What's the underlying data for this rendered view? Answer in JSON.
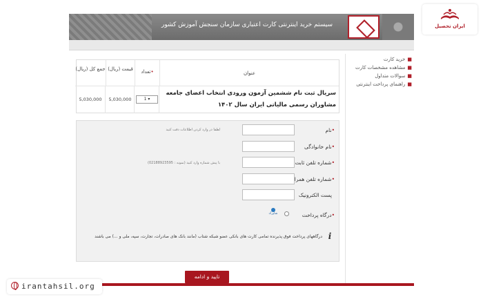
{
  "banner": {
    "title": "سیستم خرید اینترنتی کارت اعتباری سازمان سنجش آموزش کشور"
  },
  "brand": {
    "name": "ایران تحصیل"
  },
  "sidebar": {
    "items": [
      {
        "label": "خرید کارت"
      },
      {
        "label": "مشاهده مشخصات کارت"
      },
      {
        "label": "سوالات متداول"
      },
      {
        "label": "راهنمای پرداخت اینترنتی"
      }
    ]
  },
  "order": {
    "headers": {
      "title": "عنوان",
      "qty": "تعداد",
      "price": "قیمت (ریال)",
      "total": "جمع کل (ریال)"
    },
    "row": {
      "title": "سریال ثبت نام ششمین آزمون ورودی انتخاب اعضای جامعه مشاوران رسمی مالیاتی ایران سال ۱۴۰۲",
      "qty": "1",
      "price": "5,030,000",
      "total": "5,030,000"
    }
  },
  "form": {
    "first_name": {
      "label": "نام",
      "required": true,
      "hint": "لطفا در وارد کردن اطلاعات دقت کنید"
    },
    "last_name": {
      "label": "نام خانوادگی",
      "required": true
    },
    "phone": {
      "label": "شماره تلفن ثابت",
      "required": true,
      "hint": "با پیش شماره وارد کنید (نمونه : 02188923595)"
    },
    "mobile": {
      "label": "شماره تلفن همراه",
      "required": true
    },
    "email": {
      "label": "پست الکترونیک",
      "required": false
    },
    "gateway": {
      "label": "درگاه پرداخت",
      "required": true,
      "option_label": "شاپرک"
    },
    "note": "درگاههای پرداخت فوق پذیرنده تمامی کارت های بانکی عضو شبکه شتاب (مانند بانک های صادرات، تجارت، سپه، ملی و ...) می باشند"
  },
  "submit": {
    "label": "تایید و ادامه"
  },
  "footer": {
    "url": "irantahsil.org"
  },
  "colors": {
    "accent": "#a8161f",
    "banner": "#777777",
    "form_bg": "#f1f1f1"
  },
  "icons": {
    "info": "info-icon",
    "globe": "globe-icon",
    "bank": "shaparak-icon"
  }
}
